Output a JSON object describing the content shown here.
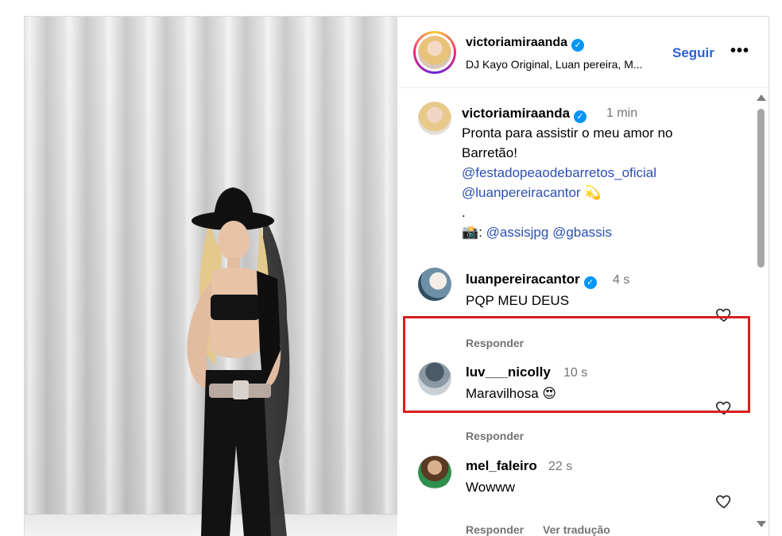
{
  "post": {
    "author": "victoriamiraanda",
    "audio": "DJ Kayo Original, Luan pereira, M...",
    "follow_label": "Seguir",
    "more_label": "•••"
  },
  "caption": {
    "author": "victoriamiraanda",
    "time": "1 min",
    "line1": "Pronta para assistir o meu amor no",
    "line2": "Barretão!",
    "mention1": "@festadopeaodebarretos_oficial",
    "mention2": "@luanpereiracantor",
    "emoji": "💫",
    "dot": ".",
    "camera_emoji": "📸",
    "photo_credit_sep": ":",
    "mention3": "@assisjpg",
    "mention4": "@gbassis"
  },
  "comments": [
    {
      "user": "luanpereiracantor",
      "verified": true,
      "time": "4 s",
      "text": "PQP MEU DEUS",
      "reply_label": "Responder"
    },
    {
      "user": "luv___nicolly",
      "verified": false,
      "time": "10 s",
      "text": "Maravilhosa",
      "emoji": "😍",
      "reply_label": "Responder"
    },
    {
      "user": "mel_faleiro",
      "verified": false,
      "time": "22 s",
      "text": "Wowww",
      "reply_label": "Responder",
      "translate_label": "Ver tradução"
    }
  ],
  "colors": {
    "accent": "#0095f6",
    "link": "#2a4fb5",
    "highlight": "#d81e1e"
  }
}
